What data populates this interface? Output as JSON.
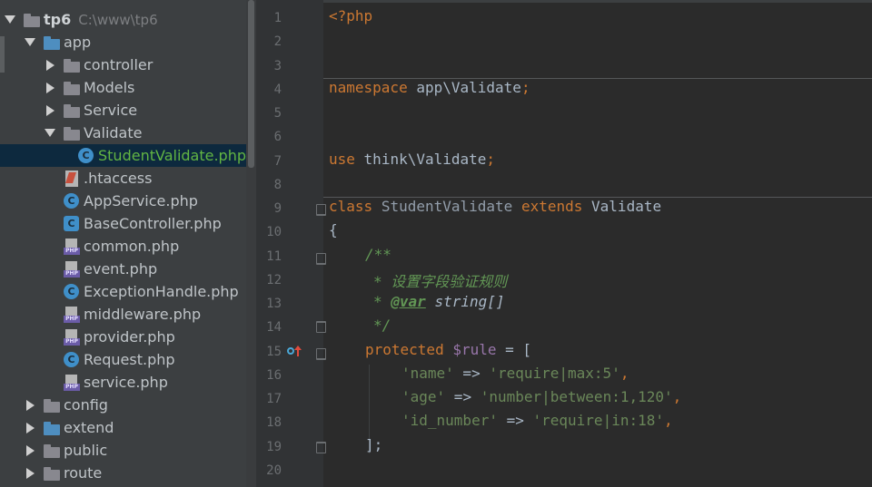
{
  "project_tree": {
    "items": [
      {
        "id": "tp6",
        "label": "tp6",
        "path": "C:\\www\\tp6",
        "icon": "folder-icon",
        "expanded": true,
        "depth": 0
      },
      {
        "id": "app",
        "label": "app",
        "icon": "blue-folder-icon",
        "expanded": true,
        "depth": 1
      },
      {
        "id": "controller",
        "label": "controller",
        "icon": "folder-icon",
        "expanded": false,
        "depth": 2
      },
      {
        "id": "models",
        "label": "Models",
        "icon": "folder-icon",
        "expanded": false,
        "depth": 2
      },
      {
        "id": "service",
        "label": "Service",
        "icon": "folder-icon",
        "expanded": false,
        "depth": 2
      },
      {
        "id": "validate",
        "label": "Validate",
        "icon": "folder-icon",
        "expanded": true,
        "depth": 2
      },
      {
        "id": "studentvalidate",
        "label": "StudentValidate.php",
        "icon": "php-class-icon",
        "selected": true,
        "depth": 3
      },
      {
        "id": "htaccess",
        "label": ".htaccess",
        "icon": "htaccess-file-icon",
        "depth": 2
      },
      {
        "id": "appservice",
        "label": "AppService.php",
        "icon": "php-class-icon",
        "depth": 2
      },
      {
        "id": "basecontroller",
        "label": "BaseController.php",
        "icon": "php-abstract-class-icon",
        "depth": 2
      },
      {
        "id": "common",
        "label": "common.php",
        "icon": "php-file-icon",
        "depth": 2
      },
      {
        "id": "event",
        "label": "event.php",
        "icon": "php-file-icon",
        "depth": 2
      },
      {
        "id": "exceptionhandle",
        "label": "ExceptionHandle.php",
        "icon": "php-class-icon",
        "depth": 2
      },
      {
        "id": "middleware",
        "label": "middleware.php",
        "icon": "php-file-icon",
        "depth": 2
      },
      {
        "id": "provider",
        "label": "provider.php",
        "icon": "php-file-icon",
        "depth": 2
      },
      {
        "id": "request",
        "label": "Request.php",
        "icon": "php-class-icon",
        "depth": 2
      },
      {
        "id": "servicephp",
        "label": "service.php",
        "icon": "php-file-icon",
        "depth": 2
      },
      {
        "id": "config",
        "label": "config",
        "icon": "folder-icon",
        "expanded": false,
        "depth": 1
      },
      {
        "id": "extend",
        "label": "extend",
        "icon": "blue-folder-icon",
        "expanded": false,
        "depth": 1
      },
      {
        "id": "public",
        "label": "public",
        "icon": "folder-icon",
        "expanded": false,
        "depth": 1
      },
      {
        "id": "route",
        "label": "route",
        "icon": "folder-icon",
        "expanded": false,
        "depth": 1
      }
    ]
  },
  "editor": {
    "line_numbers": [
      "1",
      "2",
      "3",
      "4",
      "5",
      "6",
      "7",
      "8",
      "9",
      "10",
      "11",
      "12",
      "13",
      "14",
      "15",
      "16",
      "17",
      "18",
      "19",
      "20"
    ],
    "code": {
      "l1_open_tag": "<?php",
      "l4_kw": "namespace",
      "l4_ns": "app\\Validate",
      "l4_semi": ";",
      "l7_kw": "use",
      "l7_ns": "think\\Validate",
      "l7_semi": ";",
      "l9_kw1": "class",
      "l9_name": "StudentValidate",
      "l9_kw2": "extends",
      "l9_parent": "Validate",
      "l10_brace": "{",
      "l11_doc_open": "/**",
      "l12_doc": "* 设置字段验证规则",
      "l13_star": "*",
      "l13_tag": "@var",
      "l13_type": "string[]",
      "l14_doc_close": "*/",
      "l15_kw": "protected",
      "l15_var": "$rule",
      "l15_rest": " = [",
      "l16_key": "'name'",
      "l16_arrow": " => ",
      "l16_val": "'require|max:5'",
      "l16_comma": ",",
      "l17_key": "'age'",
      "l17_arrow": " => ",
      "l17_val": "'number|between:1,120'",
      "l17_comma": ",",
      "l18_key": "'id_number'",
      "l18_arrow": " => ",
      "l18_val": "'require|in:18'",
      "l18_comma": ",",
      "l19_close": "];"
    }
  },
  "colors": {
    "keyword": "#cc7832",
    "string": "#6a8759",
    "comment": "#629755",
    "variable": "#9876aa",
    "default_text": "#a9b7c6",
    "selected_file": "#62b543"
  }
}
